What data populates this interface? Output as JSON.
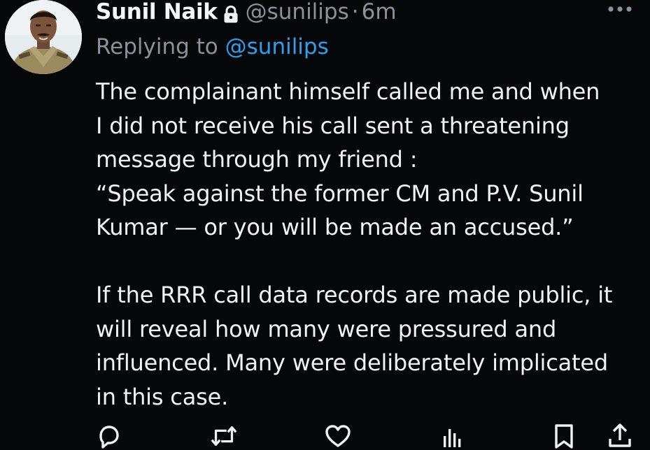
{
  "author": {
    "display_name": "Sunil Naik",
    "handle": "@sunilips",
    "separator": "·",
    "time": "6m"
  },
  "reply": {
    "prefix": "Replying to",
    "mention": "@sunilips"
  },
  "tweet_text": "The complainant himself called me and when\nI did not receive his call sent a threatening\nmessage through my friend :\n“Speak against the former CM and P.V. Sunil\nKumar — or you will be made an accused.”\n\nIf the RRR call data records are made public, it\nwill reveal how many were pressured and\ninfluenced. Many were deliberately implicated\nin this case.",
  "icons": {
    "lock": "lock-icon",
    "more": "more-icon",
    "reply": "reply-icon",
    "retweet": "retweet-icon",
    "like": "heart-icon",
    "views": "views-icon",
    "bookmark": "bookmark-icon",
    "share": "share-icon"
  },
  "colors": {
    "background": "#060709",
    "text": "#f1f2f3",
    "muted": "#8b9299",
    "link": "#2d9ff0"
  }
}
